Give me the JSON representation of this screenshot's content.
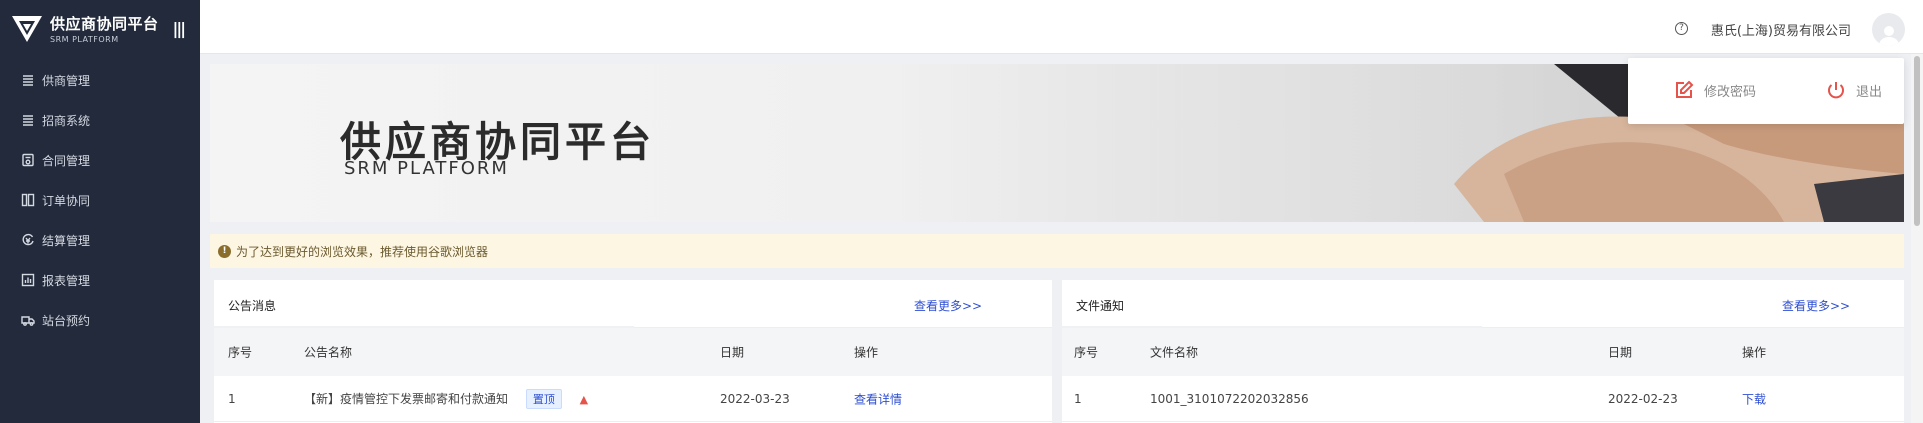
{
  "brand": {
    "title": "供应商协同平台",
    "subtitle": "SRM PLATFORM",
    "collapse_icon": "menu-collapse-icon"
  },
  "sidebar": {
    "items": [
      {
        "label": "供商管理",
        "icon": "list-icon"
      },
      {
        "label": "招商系统",
        "icon": "list-icon"
      },
      {
        "label": "合同管理",
        "icon": "contract-icon"
      },
      {
        "label": "订单协同",
        "icon": "order-icon"
      },
      {
        "label": "结算管理",
        "icon": "settlement-icon"
      },
      {
        "label": "报表管理",
        "icon": "report-icon"
      },
      {
        "label": "站台预约",
        "icon": "truck-icon"
      }
    ]
  },
  "header": {
    "help": "?",
    "company": "惠氏(上海)贸易有限公司"
  },
  "dropdown": {
    "change_password": "修改密码",
    "logout": "退出"
  },
  "banner": {
    "title": "供应商协同平台",
    "subtitle": "SRM PLATFORM"
  },
  "notice": {
    "text": "为了达到更好的浏览效果，推荐使用谷歌浏览器"
  },
  "announcements": {
    "title": "公告消息",
    "more": "查看更多>>",
    "columns": [
      "序号",
      "公告名称",
      "日期",
      "操作"
    ],
    "rows": [
      {
        "no": "1",
        "name": "【新】疫情管控下发票邮寄和付款通知",
        "tag": "置顶",
        "date": "2022-03-23",
        "action": "查看详情"
      }
    ]
  },
  "files": {
    "title": "文件通知",
    "more": "查看更多>>",
    "columns": [
      "序号",
      "文件名称",
      "日期",
      "操作"
    ],
    "rows": [
      {
        "no": "1",
        "name": "1001_3101072202032856",
        "date": "2022-02-23",
        "action": "下载"
      }
    ]
  },
  "colors": {
    "sidebar_bg": "#222a3b",
    "link": "#2f4fd1",
    "accent_red": "#e5534b",
    "notice_bg": "#fdf6e3"
  }
}
